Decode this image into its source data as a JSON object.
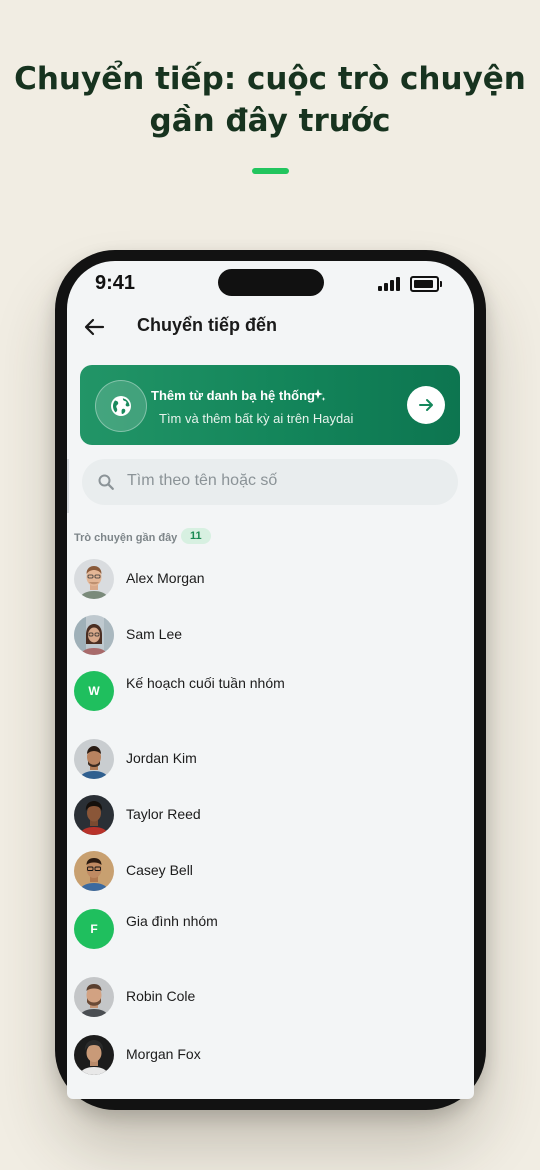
{
  "headline": {
    "line1": "Chuyển tiếp: cuộc trò chuyện",
    "line2": "gần đây trước"
  },
  "status_bar": {
    "time": "9:41"
  },
  "nav": {
    "title": "Chuyển tiếp đến"
  },
  "promo": {
    "title": "Thêm từ danh bạ hệ thống",
    "subtitle": "Tìm và thêm bất kỳ ai trên Haydai"
  },
  "search": {
    "placeholder": "Tìm theo tên hoặc số"
  },
  "recent": {
    "label": "Trò chuyện gần đây",
    "count": "11",
    "items": [
      {
        "name": "Alex Morgan"
      },
      {
        "name": "Sam Lee"
      },
      {
        "name": "Kế hoạch cuối tuần nhóm",
        "initial": "W"
      },
      {
        "name": "Jordan Kim"
      },
      {
        "name": "Taylor Reed"
      },
      {
        "name": "Casey Bell"
      },
      {
        "name": "Gia đình nhóm",
        "initial": "F"
      },
      {
        "name": "Robin Cole"
      },
      {
        "name": "Morgan Fox"
      }
    ]
  },
  "colors": {
    "accent": "#22c55e",
    "promo_gradient_start": "#229567",
    "promo_gradient_end": "#0d7550",
    "group_avatar": "#1fbf5e",
    "page_background": "#f1ede3"
  }
}
